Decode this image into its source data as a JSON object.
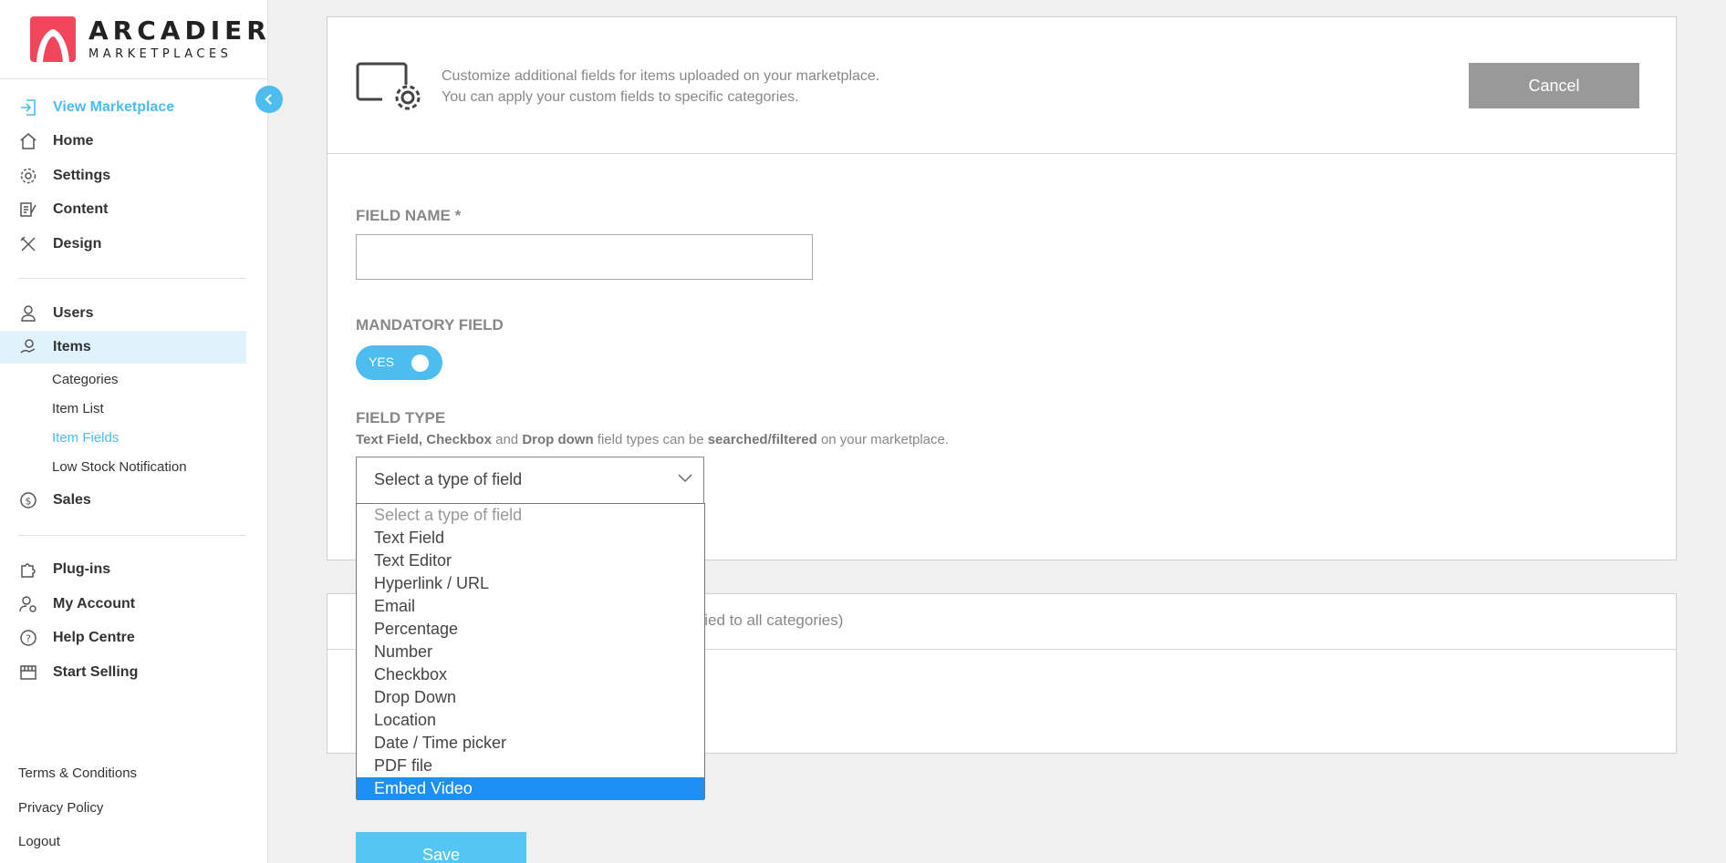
{
  "brand": {
    "title": "ARCADIER",
    "subtitle": "MARKETPLACES",
    "accent": "#f0455a",
    "link_color": "#4dbcef"
  },
  "sidebar": {
    "primary": [
      {
        "label": "View Marketplace",
        "icon": "view-marketplace-icon"
      },
      {
        "label": "Home",
        "icon": "home-icon"
      },
      {
        "label": "Settings",
        "icon": "settings-gear-icon"
      },
      {
        "label": "Content",
        "icon": "content-icon"
      },
      {
        "label": "Design",
        "icon": "design-tools-icon"
      }
    ],
    "secondary": [
      {
        "label": "Users",
        "icon": "user-icon"
      },
      {
        "label": "Items",
        "icon": "items-hand-icon"
      }
    ],
    "items_sub": [
      "Categories",
      "Item List",
      "Item Fields",
      "Low Stock Notification"
    ],
    "sales": {
      "label": "Sales",
      "icon": "dollar-circle-icon"
    },
    "tertiary": [
      {
        "label": "Plug-ins",
        "icon": "puzzle-icon"
      },
      {
        "label": "My Account",
        "icon": "account-gear-icon"
      },
      {
        "label": "Help Centre",
        "icon": "help-circle-icon"
      },
      {
        "label": "Start Selling",
        "icon": "storefront-icon"
      }
    ],
    "footer": [
      "Terms & Conditions",
      "Privacy Policy",
      "Logout"
    ]
  },
  "header": {
    "line1": "Customize additional fields for items uploaded on your marketplace.",
    "line2": "You can apply your custom fields to specific categories.",
    "cancel_label": "Cancel"
  },
  "form": {
    "field_name_label": "FIELD NAME *",
    "field_name_value": "",
    "mandatory_label": "MANDATORY FIELD",
    "mandatory_toggle": "YES",
    "field_type_label": "FIELD TYPE",
    "hint_b1": "Text Field, Checkbox",
    "hint_t1": " and ",
    "hint_b2": "Drop down",
    "hint_t2": " field types can be ",
    "hint_b3": "searched/filtered",
    "hint_t3": " on your marketplace.",
    "select_value": "Select a type of field",
    "options": [
      "Select a type of field",
      "Text Field",
      "Text Editor",
      "Hyperlink / URL",
      "Email",
      "Percentage",
      "Number",
      "Checkbox",
      "Drop Down",
      "Location",
      "Date / Time picker",
      "PDF file",
      "Embed Video"
    ],
    "highlighted_option": "Embed Video"
  },
  "categories_card": {
    "partial_text": "plied to all categories)"
  },
  "save_label": "Save"
}
